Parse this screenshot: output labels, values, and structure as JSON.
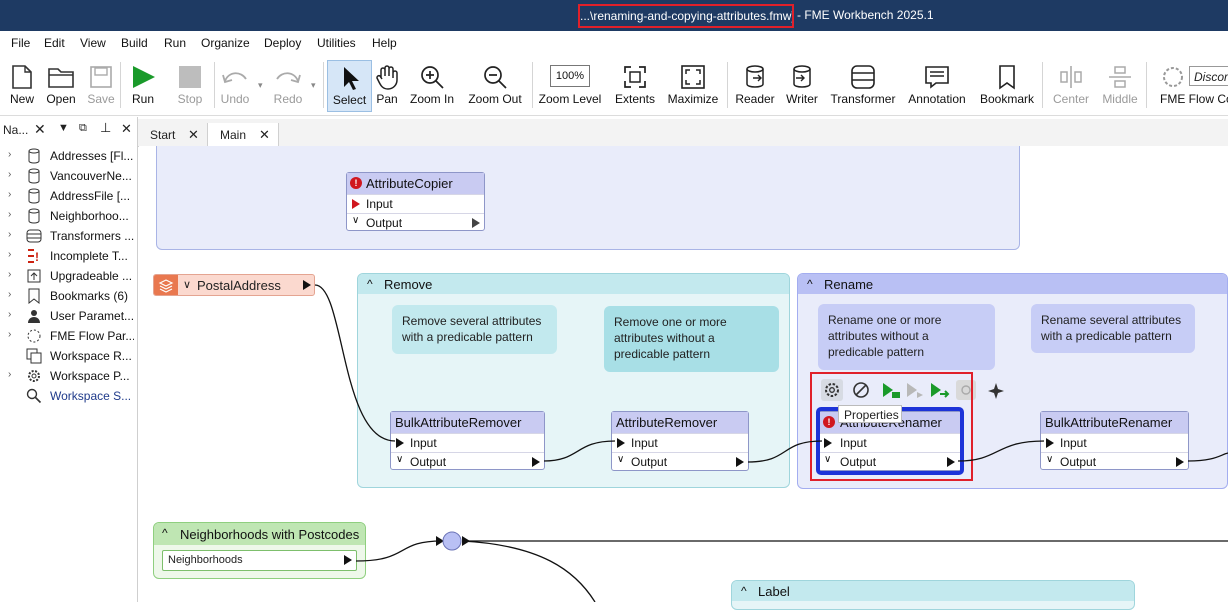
{
  "window": {
    "title_path": "...\\renaming-and-copying-attributes.fmw]",
    "title_app": "- FME Workbench 2025.1"
  },
  "menu": [
    "File",
    "Edit",
    "View",
    "Build",
    "Run",
    "Organize",
    "Deploy",
    "Utilities",
    "Help"
  ],
  "toolbar": {
    "new": "New",
    "open": "Open",
    "save": "Save",
    "run": "Run",
    "stop": "Stop",
    "undo": "Undo",
    "redo": "Redo",
    "select": "Select",
    "pan": "Pan",
    "zoom_in": "Zoom In",
    "zoom_out": "Zoom Out",
    "zoom_level_value": "100%",
    "zoom_level": "Zoom Level",
    "extents": "Extents",
    "maximize": "Maximize",
    "reader": "Reader",
    "writer": "Writer",
    "transformer": "Transformer",
    "annotation": "Annotation",
    "bookmark": "Bookmark",
    "center": "Center",
    "middle": "Middle",
    "fme_flow": "FME Flow Co",
    "discover_value": "Discor"
  },
  "navigator": {
    "title": "Na...",
    "items": [
      "Addresses [Fl...",
      "VancouverNe...",
      "AddressFile [...",
      "Neighborhoo...",
      "Transformers ...",
      "Incomplete T...",
      "Upgradeable ...",
      "Bookmarks (6)",
      "User Paramet...",
      "FME Flow Par...",
      "Workspace R...",
      "Workspace P...",
      "Workspace S..."
    ]
  },
  "tabs": [
    "Start",
    "Main"
  ],
  "canvas": {
    "top_transformer": {
      "name": "AttributeCopier",
      "input": "Input",
      "output": "Output"
    },
    "postal_reader": "PostalAddress",
    "remove_bookmark": {
      "title": "Remove",
      "note1": "Remove several attributes with a predicable pattern",
      "note2": "Remove one or more attributes without a predicable pattern",
      "xf1": {
        "name": "BulkAttributeRemover",
        "input": "Input",
        "output": "Output"
      },
      "xf2": {
        "name": "AttributeRemover",
        "input": "Input",
        "output": "Output"
      }
    },
    "rename_bookmark": {
      "title": "Rename",
      "note1": "Rename one or more attributes without a predicable pattern",
      "note2": "Rename several attributes with a predicable pattern",
      "xf1": {
        "name": "AttributeRenamer",
        "input": "Input",
        "output": "Output"
      },
      "xf2": {
        "name": "BulkAttributeRenamer",
        "input": "Input",
        "output": "Output"
      },
      "tooltip": "Properties"
    },
    "neighborhoods_bookmark": {
      "title": "Neighborhoods with Postcodes",
      "reader": "Neighborhoods"
    },
    "label_bookmark": {
      "title": "Label"
    }
  },
  "colors": {
    "titlebar": "#1e3a63",
    "highlight": "#e0202a",
    "selection_box": "#1d33d8",
    "transformer_header": "#c9cbf2",
    "bookmark_cyan": "#e6f5f7",
    "bookmark_blue": "#e9ecfa"
  }
}
